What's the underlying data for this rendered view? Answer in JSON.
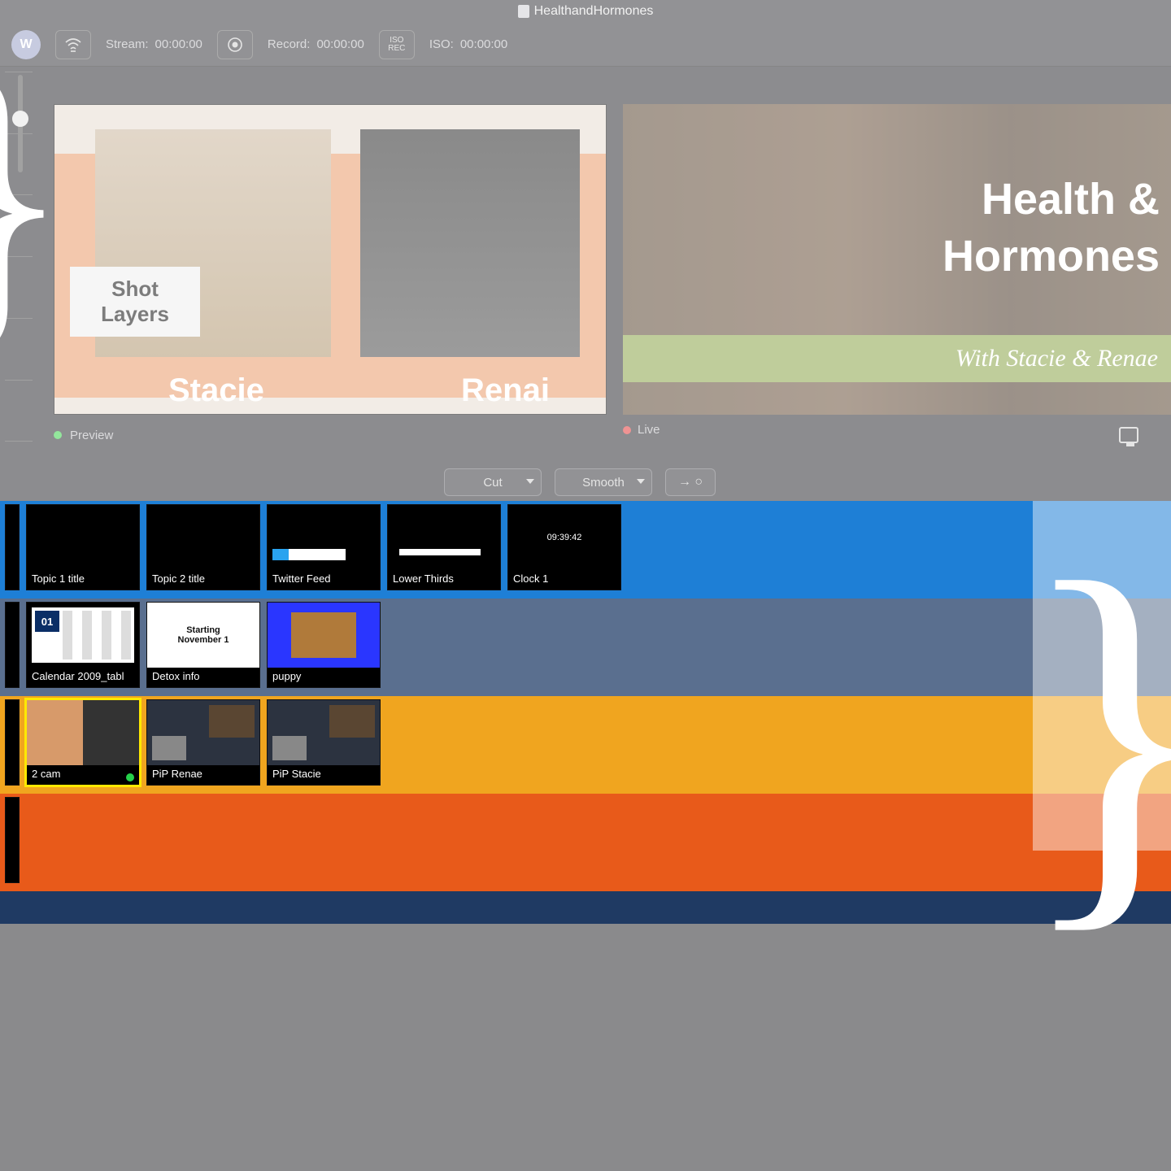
{
  "titlebar": {
    "document": "HealthandHormones"
  },
  "toolbar": {
    "stream_label": "Stream:",
    "stream_time": "00:00:00",
    "record_label": "Record:",
    "record_time": "00:00:00",
    "iso_label": "ISO:",
    "iso_time": "00:00:00",
    "iso_btn": "ISO\nREC"
  },
  "preview": {
    "left_name": "Stacie",
    "right_name": "Renai",
    "shot_layers_label": "Shot\nLayers",
    "status": "Preview"
  },
  "live": {
    "line1": "Health &",
    "line2": "Hormones",
    "ribbon": "With Stacie & Renae",
    "status": "Live"
  },
  "transition": {
    "cut": "Cut",
    "smooth": "Smooth",
    "go": "→  ○"
  },
  "rows": [
    {
      "color": "blue",
      "shots": [
        {
          "label": "",
          "kind": "blank"
        },
        {
          "label": "Topic 1 title",
          "kind": "blank"
        },
        {
          "label": "Topic 2 title",
          "kind": "blank"
        },
        {
          "label": "Twitter Feed",
          "kind": "twitter"
        },
        {
          "label": "Lower Thirds",
          "kind": "lt"
        },
        {
          "label": "Clock 1",
          "kind": "clock",
          "clock": "09:39:42"
        }
      ]
    },
    {
      "color": "slate",
      "shots": [
        {
          "label": "",
          "kind": "blank"
        },
        {
          "label": "Calendar 2009_tabl",
          "kind": "cal",
          "day": "01"
        },
        {
          "label": "Detox info",
          "kind": "detox",
          "text": "Starting\nNovember 1"
        },
        {
          "label": "puppy",
          "kind": "puppy"
        }
      ]
    },
    {
      "color": "gold",
      "shots": [
        {
          "label": "",
          "kind": "blank"
        },
        {
          "label": "2 cam",
          "kind": "2cam",
          "selected": true,
          "rec": true
        },
        {
          "label": "PiP Renae",
          "kind": "pip"
        },
        {
          "label": "PiP Stacie",
          "kind": "pip"
        }
      ]
    },
    {
      "color": "orange",
      "shots": [
        {
          "label": "",
          "kind": "solid"
        }
      ]
    },
    {
      "color": "navy",
      "shots": []
    }
  ]
}
